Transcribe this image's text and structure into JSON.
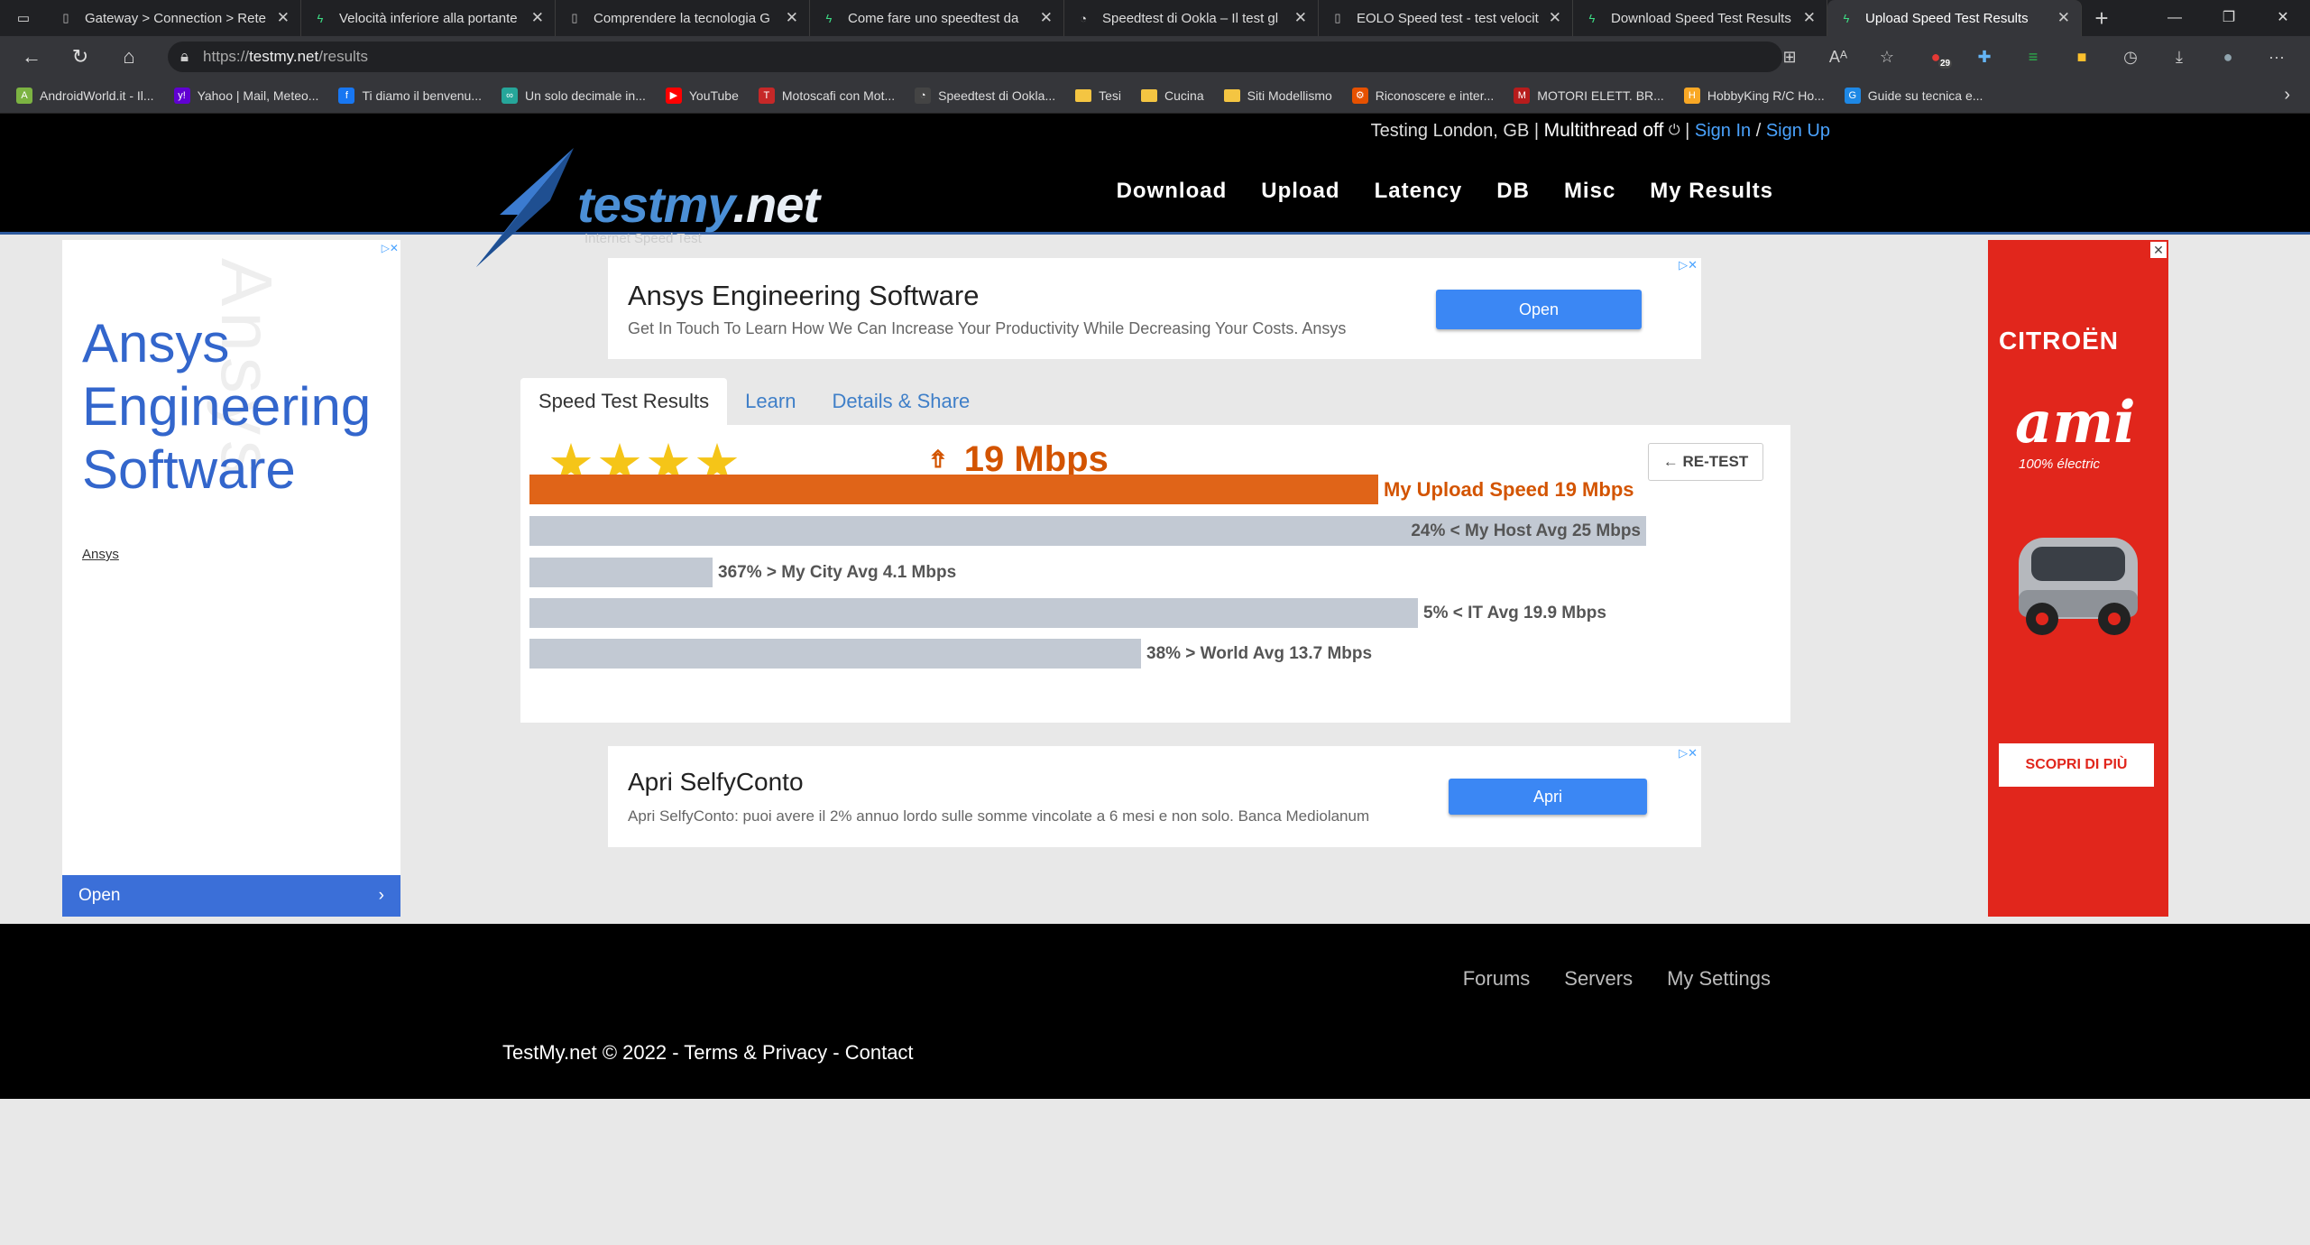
{
  "browser": {
    "tabs": [
      {
        "title": "Gateway > Connection > Rete",
        "icon": "page-icon"
      },
      {
        "title": "Velocità inferiore alla portante",
        "icon": "bolt-icon"
      },
      {
        "title": "Comprendere la tecnologia G",
        "icon": "page-icon"
      },
      {
        "title": "Come fare uno speedtest da",
        "icon": "bolt-icon"
      },
      {
        "title": "Speedtest di Ookla – Il test gl",
        "icon": "gauge-icon"
      },
      {
        "title": "EOLO Speed test - test velocit",
        "icon": "page-icon"
      },
      {
        "title": "Download Speed Test Results",
        "icon": "bolt-icon"
      },
      {
        "title": "Upload Speed Test Results",
        "icon": "bolt-icon"
      }
    ],
    "url_scheme": "https://",
    "url_host": "testmy.net",
    "url_path": "/results",
    "ext_badge": "29",
    "bookmarks": [
      {
        "label": "AndroidWorld.it - Il...",
        "color": "#7cb342",
        "glyph": "A"
      },
      {
        "label": "Yahoo | Mail, Meteo...",
        "color": "#6001d2",
        "glyph": "y!"
      },
      {
        "label": "Ti diamo il benvenu...",
        "color": "#1877f2",
        "glyph": "f"
      },
      {
        "label": "Un solo decimale in...",
        "color": "#26a69a",
        "glyph": "∞"
      },
      {
        "label": "YouTube",
        "color": "#ff0000",
        "glyph": "▶"
      },
      {
        "label": "Motoscafi con Mot...",
        "color": "#c62828",
        "glyph": "T"
      },
      {
        "label": "Speedtest di Ookla...",
        "color": "#444",
        "glyph": "◔"
      },
      {
        "label": "Tesi",
        "color": "#f4c542",
        "glyph": ""
      },
      {
        "label": "Cucina",
        "color": "#f4c542",
        "glyph": ""
      },
      {
        "label": "Siti Modellismo",
        "color": "#f4c542",
        "glyph": ""
      },
      {
        "label": "Riconoscere e inter...",
        "color": "#e65100",
        "glyph": "⚙"
      },
      {
        "label": "MOTORI ELETT. BR...",
        "color": "#b71c1c",
        "glyph": "M"
      },
      {
        "label": "HobbyKing R/C Ho...",
        "color": "#f9a825",
        "glyph": "H"
      },
      {
        "label": "Guide su tecnica e...",
        "color": "#1e88e5",
        "glyph": "G"
      }
    ]
  },
  "site": {
    "topbar": {
      "testing": "Testing London, GB",
      "sep1": "|",
      "multithread": "Multithread off",
      "sep2": "|",
      "signin": "Sign In",
      "slash": "/",
      "signup": "Sign Up"
    },
    "logo": {
      "word": "testmy",
      "tld": ".net",
      "tagline": "Internet Speed Test"
    },
    "nav": [
      "Download",
      "Upload",
      "Latency",
      "DB",
      "Misc",
      "My Results"
    ],
    "ad_top": {
      "title": "Ansys Engineering Software",
      "desc": "Get In Touch To Learn How We Can Increase Your Productivity While Decreasing Your Costs. Ansys",
      "button": "Open"
    },
    "ad_bottom": {
      "title": "Apri SelfyConto",
      "desc": "Apri SelfyConto: puoi avere il 2% annuo lordo sulle somme vincolate a 6 mesi e non solo. Banca Mediolanum",
      "button": "Apri"
    },
    "ad_left": {
      "title": "Ansys Engineering Software",
      "watermark": "Ansys",
      "brand": "Ansys",
      "button": "Open"
    },
    "ad_right": {
      "brand": "CITROËN",
      "model": "ami",
      "sub": "100% électric",
      "cta": "SCOPRI DI PIÙ"
    },
    "result_tabs": [
      "Speed Test Results",
      "Learn",
      "Details & Share"
    ],
    "result": {
      "stars": "★★★★",
      "speed": "19 Mbps",
      "retest": "← RE-TEST",
      "bars": [
        {
          "label": "My Upload Speed 19 Mbps",
          "fraction": 0.76,
          "kind": "me",
          "inside": false
        },
        {
          "label": "24% < My Host Avg 25 Mbps",
          "fraction": 1.0,
          "kind": "avg",
          "inside": true
        },
        {
          "label": "367% > My City Avg 4.1 Mbps",
          "fraction": 0.164,
          "kind": "avg",
          "inside": false
        },
        {
          "label": "5% < IT Avg 19.9 Mbps",
          "fraction": 0.796,
          "kind": "avg",
          "inside": false
        },
        {
          "label": "38% > World Avg 13.7 Mbps",
          "fraction": 0.548,
          "kind": "avg",
          "inside": false
        }
      ]
    },
    "footer": {
      "links": [
        "Forums",
        "Servers",
        "My Settings"
      ],
      "copyright": "TestMy.net © 2022 - Terms & Privacy - Contact"
    }
  }
}
